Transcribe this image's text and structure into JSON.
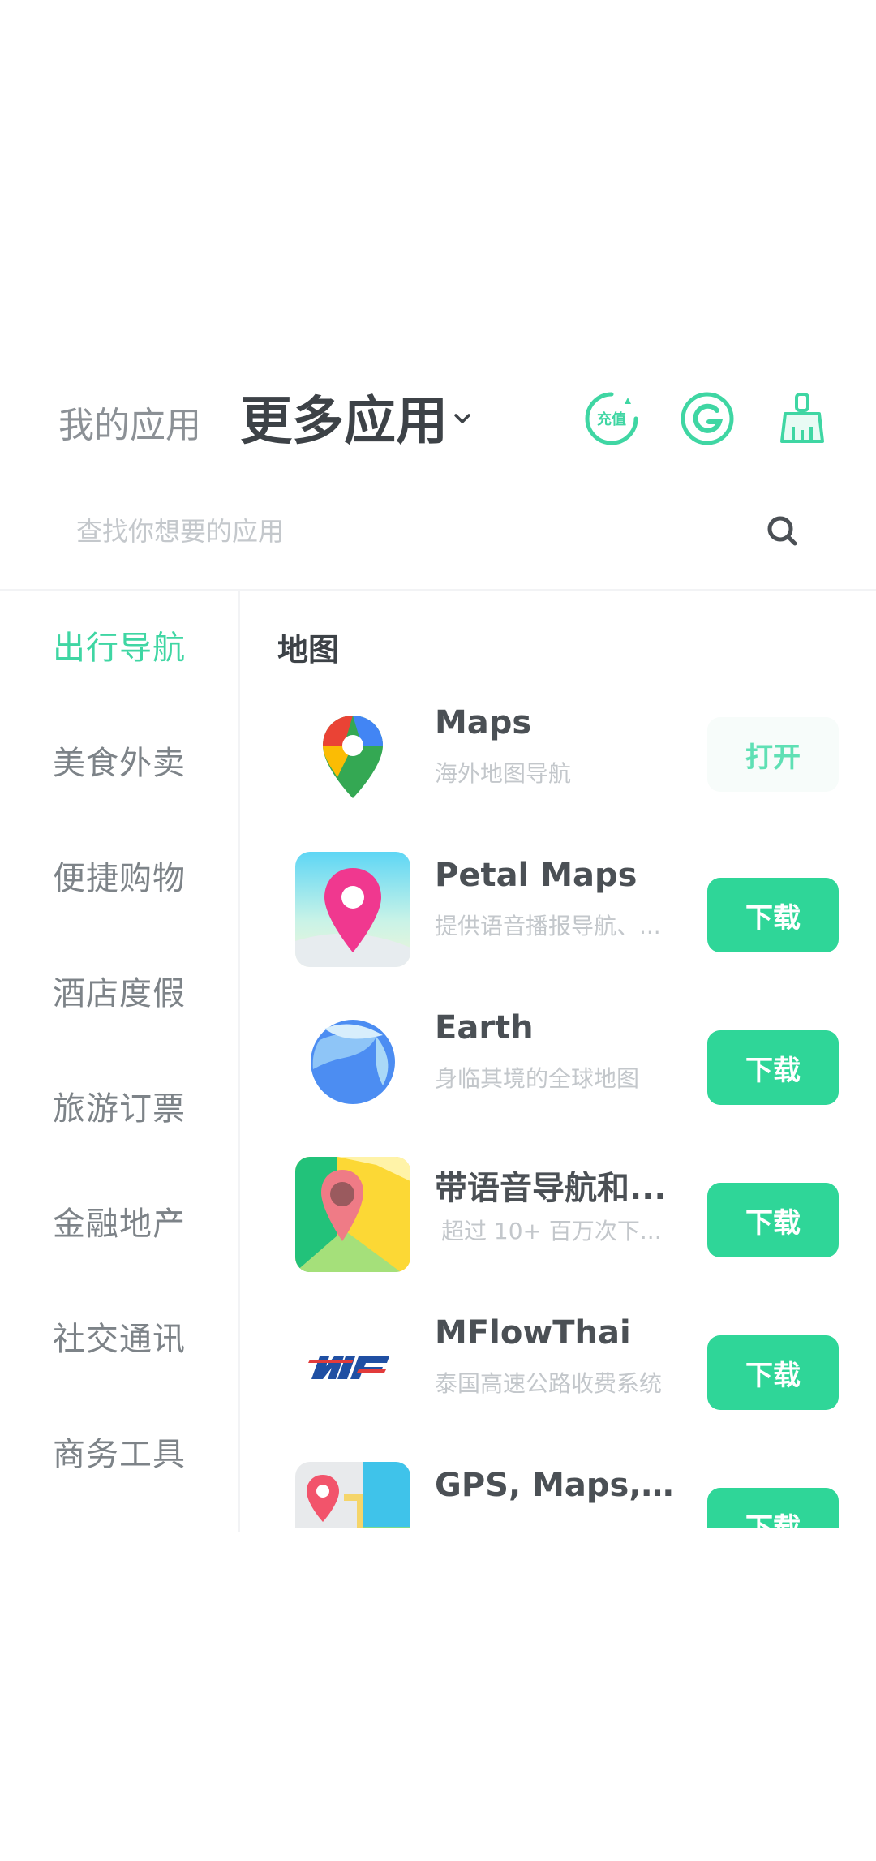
{
  "header": {
    "tab_my_apps": "我的应用",
    "tab_more_apps": "更多应用",
    "icon_recharge_text": "充值",
    "colors": {
      "accent": "#3fd6a3",
      "button": "#2fd698"
    }
  },
  "search": {
    "placeholder": "查找你想要的应用"
  },
  "sidebar": {
    "items": [
      {
        "label": "出行导航",
        "active": true
      },
      {
        "label": "美食外卖"
      },
      {
        "label": "便捷购物"
      },
      {
        "label": "酒店度假"
      },
      {
        "label": "旅游订票"
      },
      {
        "label": "金融地产"
      },
      {
        "label": "社交通讯"
      },
      {
        "label": "商务工具"
      }
    ]
  },
  "main": {
    "section_title": "地图",
    "apps": [
      {
        "name": "Maps",
        "desc": "海外地图导航",
        "button": "打开",
        "icon": "google-maps-icon"
      },
      {
        "name": "Petal Maps",
        "desc": "提供语音播报导航、...",
        "button": "下载",
        "icon": "petal-maps-icon"
      },
      {
        "name": "Earth",
        "desc": "身临其境的全球地图",
        "button": "下载",
        "icon": "earth-icon"
      },
      {
        "name": "带语音导航和...",
        "desc": "超过 10+ 百万次下...",
        "button": "下载",
        "icon": "voice-nav-map-icon"
      },
      {
        "name": "MFlowThai",
        "desc": "泰国高速公路收费系统",
        "button": "下载",
        "icon": "mflowthai-icon"
      },
      {
        "name": "GPS, Maps, V...",
        "desc": "",
        "button": "下载",
        "icon": "gps-maps-icon"
      }
    ]
  }
}
